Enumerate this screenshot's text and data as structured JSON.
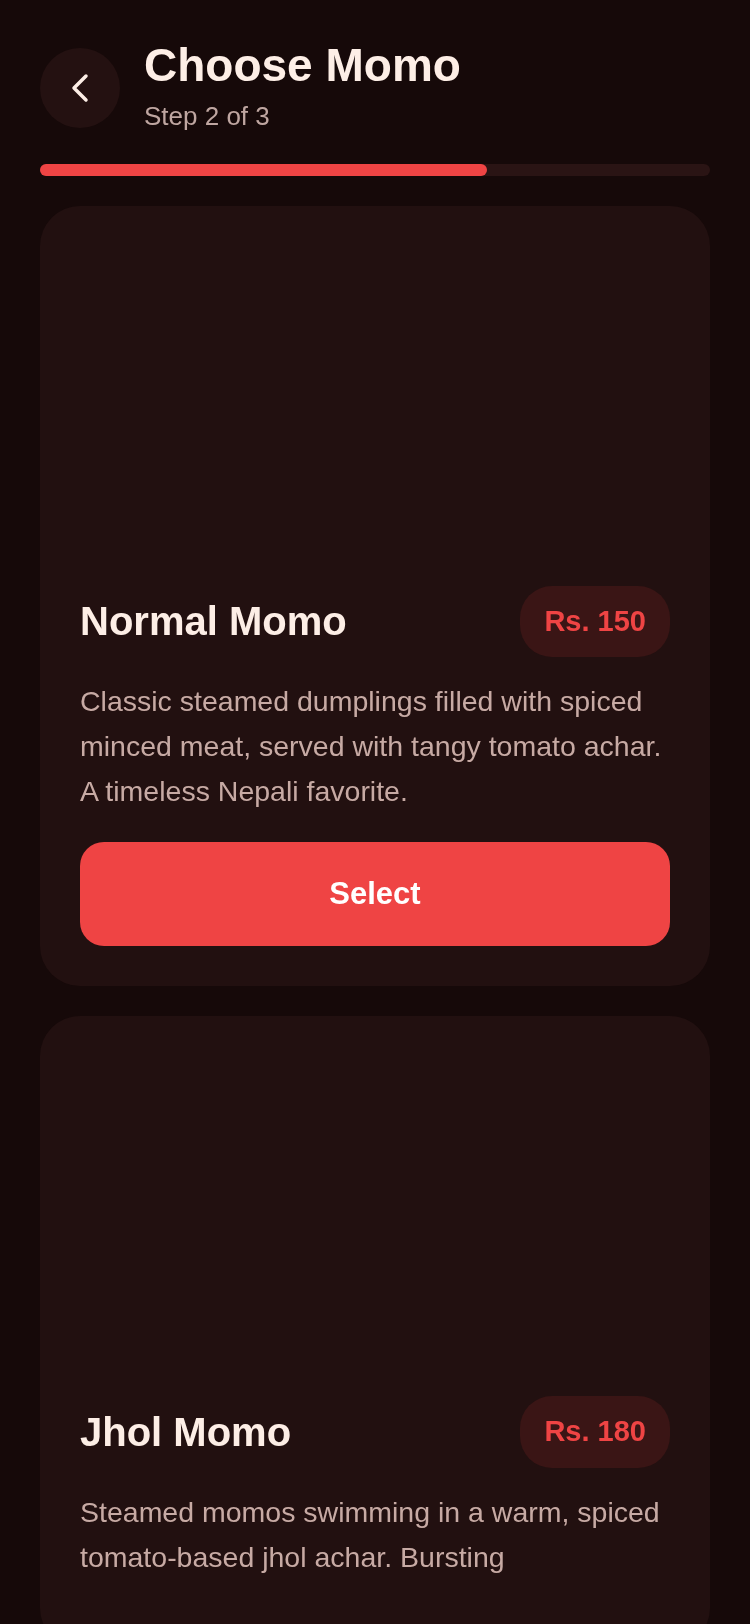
{
  "header": {
    "title": "Choose Momo",
    "subtitle": "Step 2 of 3"
  },
  "progress": {
    "level": 0.667
  },
  "items": [
    {
      "name": "Normal Momo",
      "price": "Rs. 150",
      "description": "Classic steamed dumplings filled with spiced minced meat, served with tangy tomato achar. A timeless Nepali favorite.",
      "button": "Select"
    },
    {
      "name": "Jhol Momo",
      "price": "Rs. 180",
      "description": "Steamed momos swimming in a warm, spiced tomato-based jhol achar. Bursting"
    }
  ]
}
